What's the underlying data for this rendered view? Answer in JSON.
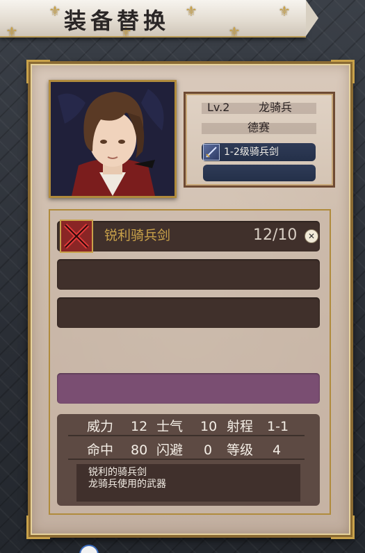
{
  "header": {
    "title": "装备替换"
  },
  "character": {
    "level": "Lv.2",
    "class": "龙骑兵",
    "name": "德赛",
    "weapon_slot_label": "1-2级骑兵剑",
    "empty_slot_label": ""
  },
  "equipment_list": {
    "items": [
      {
        "name": "锐利骑兵剑",
        "count": "12/10",
        "icon": "crossed-out-weapon-icon",
        "unequip_icon": "close-icon"
      }
    ],
    "selected_color": "#7a4e72"
  },
  "stats": {
    "rows": [
      [
        {
          "label": "威力",
          "value": "12"
        },
        {
          "label": "士气",
          "value": "10"
        },
        {
          "label": "射程",
          "value": "1-1"
        }
      ],
      [
        {
          "label": "命中",
          "value": "80"
        },
        {
          "label": "闪避",
          "value": "0"
        },
        {
          "label": "等级",
          "value": "4"
        }
      ]
    ],
    "description_title": "锐利的骑兵剑",
    "description_text": "龙骑兵使用的武器"
  },
  "colors": {
    "gold": "#c9a24a",
    "row_dark": "#40302b",
    "slot_blue": "#2f3b57"
  }
}
